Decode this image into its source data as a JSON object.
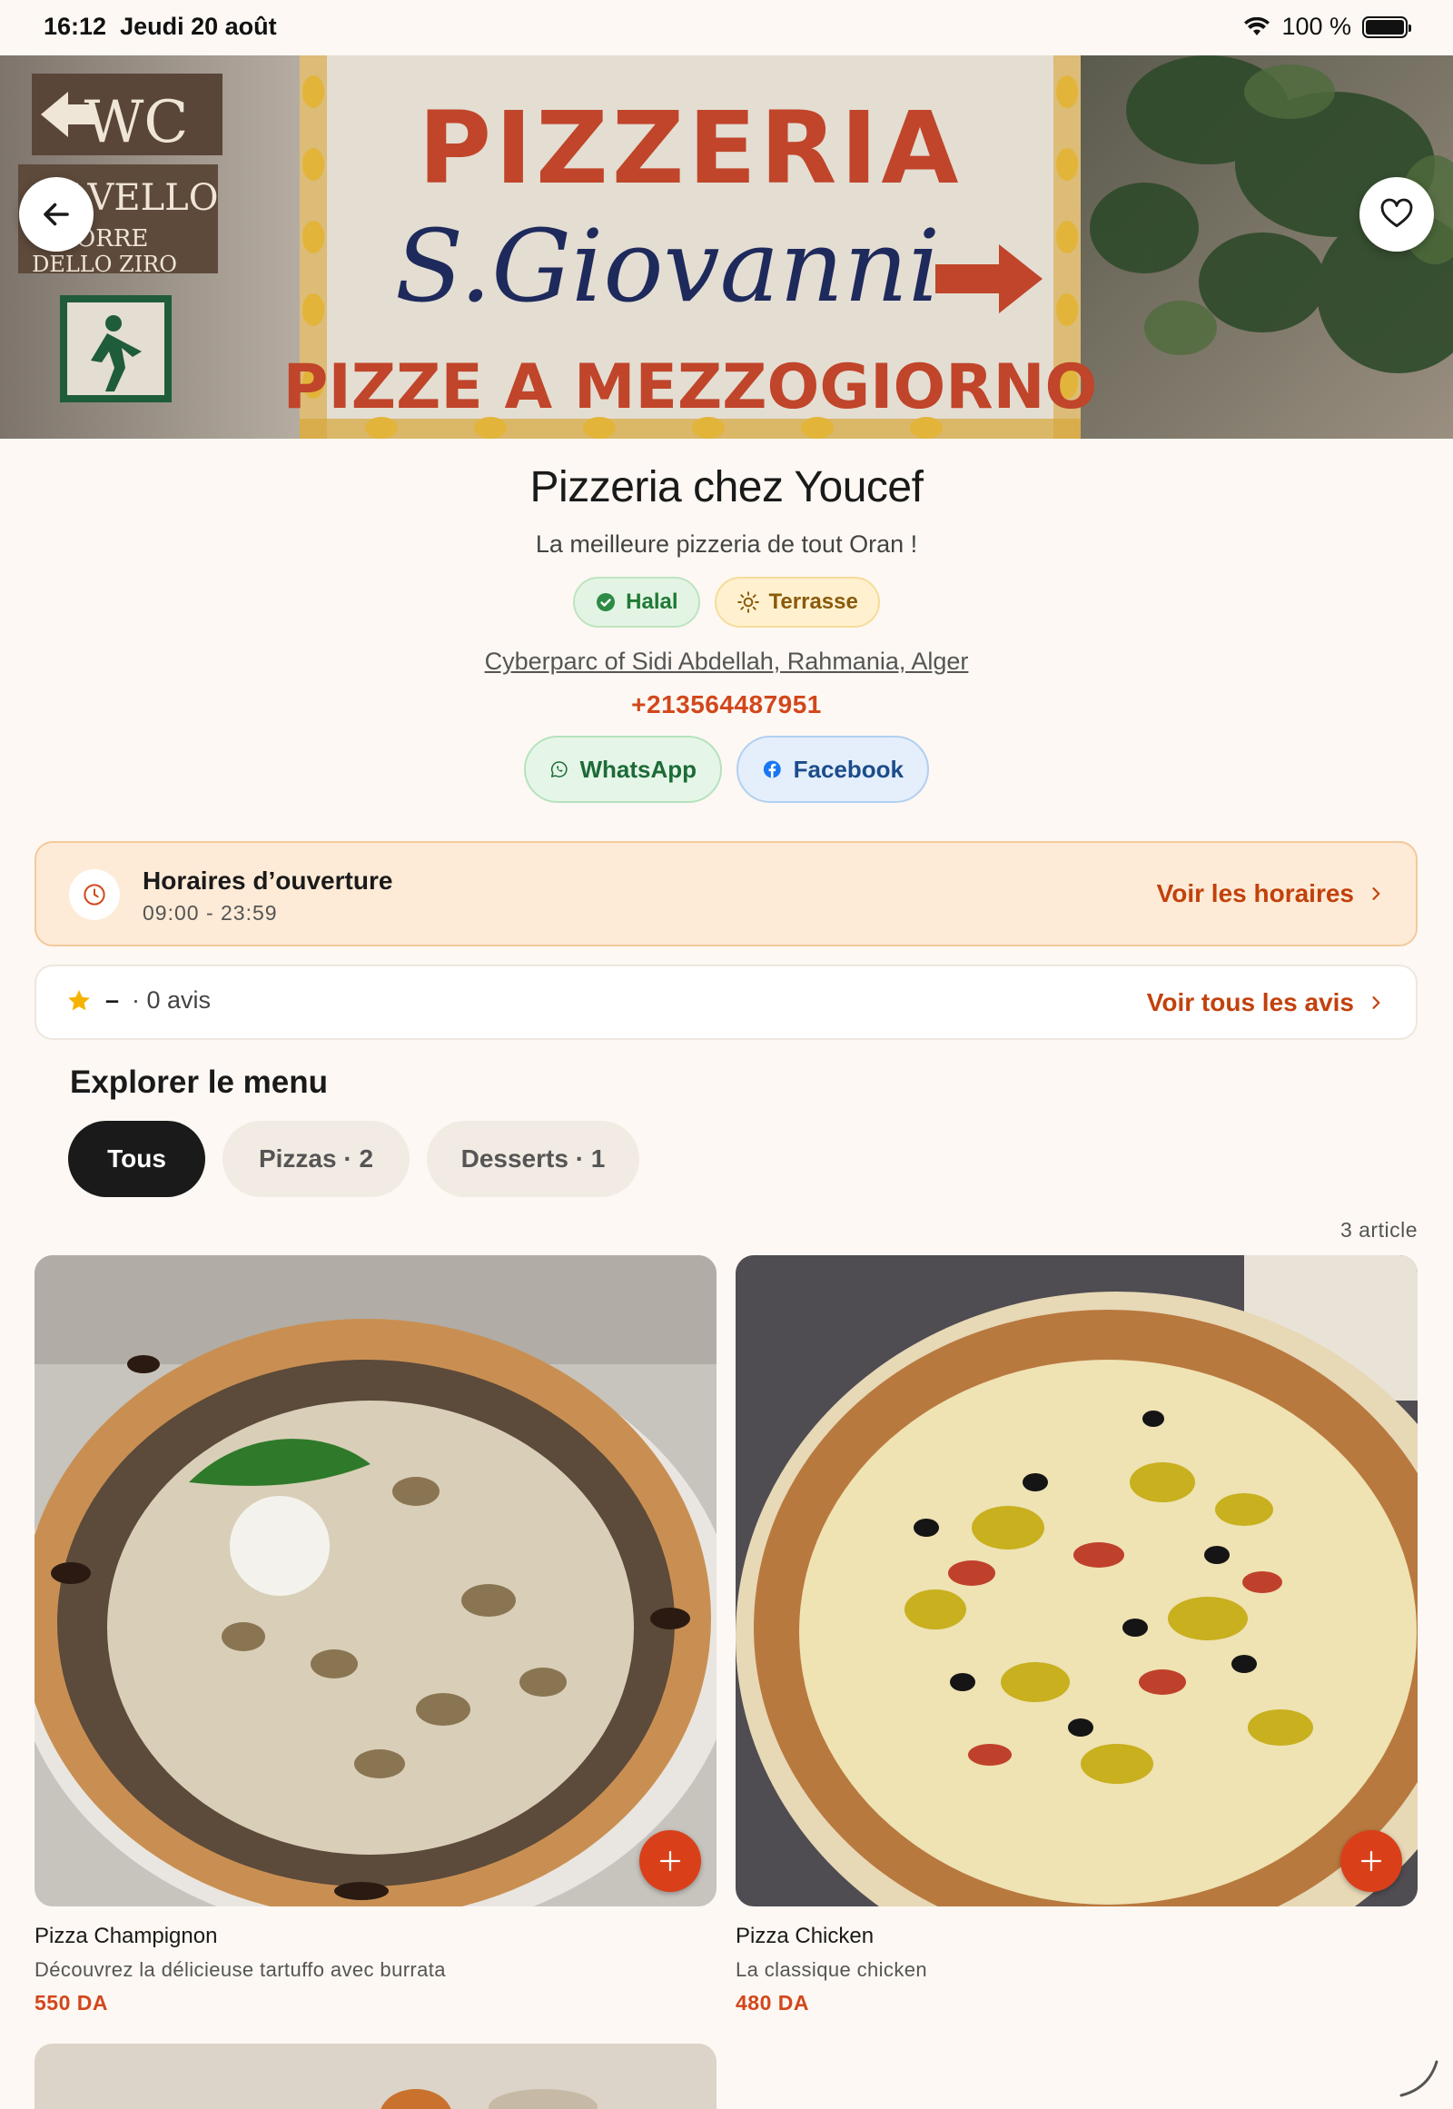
{
  "status_bar": {
    "time": "16:12",
    "date": "Jeudi 20 août",
    "battery": "100 %"
  },
  "hero": {
    "sign_line_1": "PIZZERIA",
    "sign_line_2": "S.Giovanni",
    "sign_line_3": "PIZZE A MEZZOGIORNO",
    "sign_wc": "WC",
    "sign_ravello": "RAVELLO",
    "sign_torre": "TORRE",
    "sign_ziro": "DELLO ZIRO",
    "back_icon": "arrow-left-icon",
    "fav_icon": "heart-icon"
  },
  "restaurant": {
    "name": "Pizzeria chez Youcef",
    "tagline": "La meilleure pizzeria de tout Oran !",
    "tags": [
      {
        "label": "Halal",
        "icon": "check-circle-icon"
      },
      {
        "label": "Terrasse",
        "icon": "sun-icon"
      }
    ],
    "address": "Cyberparc of Sidi Abdellah, Rahmania, Alger",
    "phone": "+213564487951",
    "socials": [
      {
        "label": "WhatsApp",
        "icon": "whatsapp-icon"
      },
      {
        "label": "Facebook",
        "icon": "facebook-icon"
      }
    ]
  },
  "hours": {
    "title": "Horaires d’ouverture",
    "time": "09:00 - 23:59",
    "link": "Voir les horaires"
  },
  "reviews": {
    "rating": "–",
    "count": "· 0 avis",
    "link": "Voir tous les avis"
  },
  "menu": {
    "title": "Explorer le menu",
    "chips": [
      {
        "label": "Tous",
        "active": true
      },
      {
        "label": "Pizzas · 2",
        "active": false
      },
      {
        "label": "Desserts · 1",
        "active": false
      }
    ],
    "article_count": "3 article",
    "items": [
      {
        "name": "Pizza Champignon",
        "description": "Découvrez la délicieuse tartuffo avec burrata",
        "price": "550 DA"
      },
      {
        "name": "Pizza Chicken",
        "description": "La classique chicken",
        "price": "480 DA"
      }
    ]
  },
  "colors": {
    "accent": "#D2471C",
    "background": "#FDF8F3",
    "hours_card": "#FEEBD7"
  }
}
